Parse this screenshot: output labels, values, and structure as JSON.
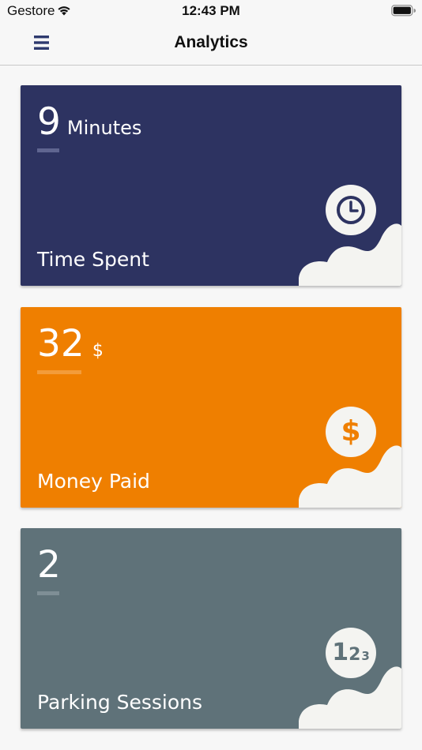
{
  "status_bar": {
    "carrier": "Gestore",
    "time": "12:43 PM"
  },
  "nav": {
    "title": "Analytics",
    "menu_icon": "hamburger-menu-icon"
  },
  "colors": {
    "nav_icon": "#2e3a6e",
    "card_background": "#f4f4f1"
  },
  "cards": [
    {
      "value": "9",
      "unit": "Minutes",
      "label": "Time Spent",
      "icon": "clock-icon",
      "color": "#2d3361",
      "underline": "#7077a0"
    },
    {
      "value": "32",
      "unit": "$",
      "label": "Money Paid",
      "icon": "dollar-icon",
      "color": "#ef7f00",
      "underline": "#f4a64d"
    },
    {
      "value": "2",
      "unit": "",
      "label": "Parking Sessions",
      "icon": "numbers-123-icon",
      "color": "#5f7279",
      "underline": "#8a9aa0"
    }
  ]
}
